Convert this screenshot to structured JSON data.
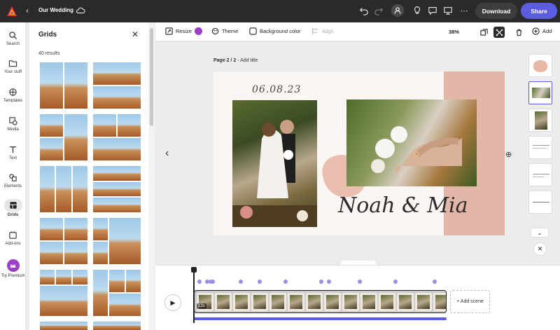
{
  "topbar": {
    "doc_title": "Our Wedding",
    "download_label": "Download",
    "share_label": "Share",
    "icons": [
      "app-logo",
      "back-chevron",
      "cloud",
      "undo",
      "redo",
      "account",
      "lightbulb",
      "comment",
      "present",
      "more"
    ]
  },
  "rail": {
    "items": [
      {
        "label": "Search",
        "icon": "search-icon"
      },
      {
        "label": "Your stuff",
        "icon": "folder-icon"
      },
      {
        "label": "Templates",
        "icon": "templates-icon"
      },
      {
        "label": "Media",
        "icon": "media-icon"
      },
      {
        "label": "Text",
        "icon": "text-icon"
      },
      {
        "label": "Elements",
        "icon": "elements-icon"
      },
      {
        "label": "Grids",
        "icon": "grids-icon",
        "active": true
      },
      {
        "label": "Add-ons",
        "icon": "addons-icon"
      },
      {
        "label": "Try Premium",
        "icon": "crown-icon"
      }
    ]
  },
  "panel": {
    "title": "Grids",
    "results": "40 results"
  },
  "toolbar": {
    "resize": "Resize",
    "theme": "Theme",
    "background_color": "Background color",
    "align": "Align",
    "zoom": "38%",
    "add": "Add"
  },
  "canvas": {
    "page_label_bold": "Page 2 / 2",
    "page_label_rest": " - Add title",
    "date_text": "06.08.23",
    "names_text": "Noah & Mia"
  },
  "timeline": {
    "add_scene": "+ Add scene",
    "duration_badge": "12s"
  },
  "colors": {
    "accent": "#5c5ce0",
    "premium": "#9c3fc7",
    "topbar_bg": "#2a2a2a",
    "card_pink": "#e3b7a8"
  }
}
